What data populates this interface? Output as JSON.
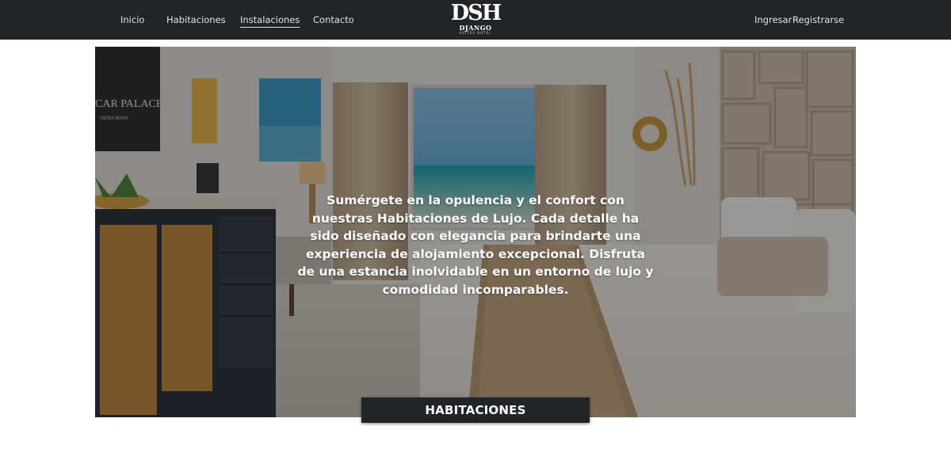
{
  "nav": {
    "links": [
      "Inicio",
      "Habitaciones",
      "Instalaciones",
      "Contacto"
    ],
    "active": "Instalaciones",
    "auth": {
      "login": "Ingresar",
      "register": "Registrarse"
    }
  },
  "brand": {
    "mark": "DSH",
    "name": "DJANGO",
    "sub": "SUITES HOTEL"
  },
  "hero": {
    "text": "Sumérgete en la opulencia y el confort con nuestras Habitaciones de Lujo. Cada detalle ha sido diseñado con elegancia para brindarte una experiencia de alojamiento excepcional. Disfruta de una estancia inolvidable en un entorno de lujo y comodidad incomparables.",
    "sign_text": "CAR PALACE",
    "sign_sub": "VIERA MAYA",
    "section_button": "HABITACIONES"
  },
  "colors": {
    "navbar": "#212529",
    "nav_text": "#e2e2e2",
    "button_bg": "#212529",
    "button_text": "#ffffff"
  },
  "icons": {
    "brand": "dsh-logo"
  }
}
